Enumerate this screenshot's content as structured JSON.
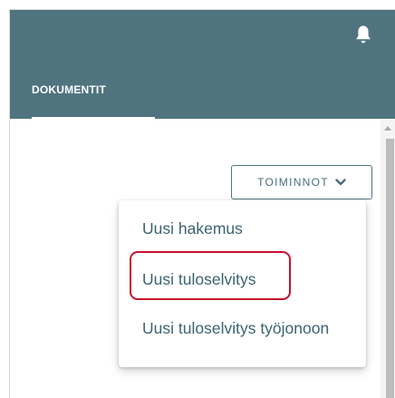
{
  "header": {
    "tab_label": "DOKUMENTIT",
    "bell_icon": "bell-icon",
    "background_color": "#4f7480"
  },
  "actions": {
    "button_label": "TOIMINNOT",
    "chevron_icon": "chevron-down-icon"
  },
  "dropdown": {
    "items": [
      {
        "label": "Uusi hakemus"
      },
      {
        "label": "Uusi tuloselvitys",
        "highlighted": true
      },
      {
        "label": "Uusi tuloselvitys työjonoon"
      }
    ],
    "text_color": "#3b6472",
    "highlight_color": "#c8102e"
  },
  "scrollbar": {
    "up_icon": "scroll-up-arrow-icon"
  }
}
